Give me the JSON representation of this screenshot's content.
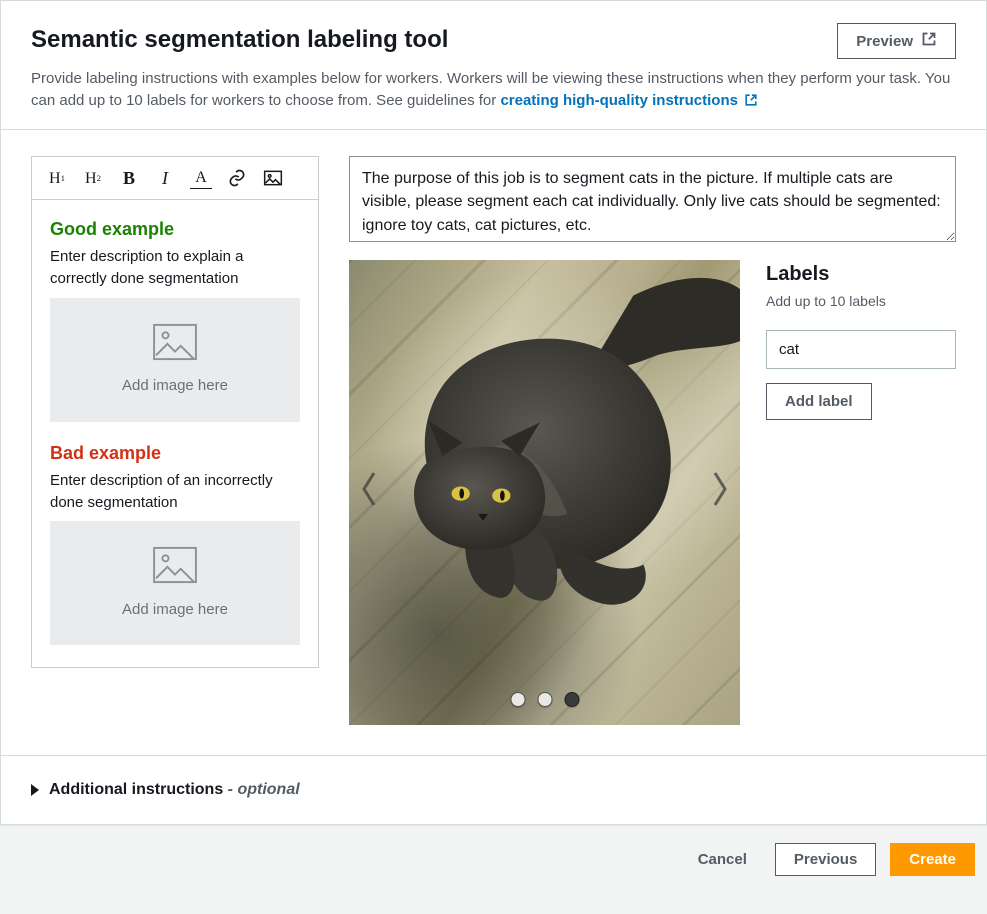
{
  "header": {
    "title": "Semantic segmentation labeling tool",
    "preview_label": "Preview",
    "description_prefix": "Provide labeling instructions with examples below for workers. Workers will be viewing these instructions when they perform your task. You can add up to 10 labels for workers to choose from. See guidelines for ",
    "description_link": "creating high-quality instructions"
  },
  "editor": {
    "toolbar": {
      "h1": "H",
      "h1_sub": "1",
      "h2": "H",
      "h2_sub": "2",
      "bold": "B",
      "italic": "I",
      "color": "A"
    },
    "good": {
      "heading": "Good example",
      "desc": "Enter description to explain a correctly done segmentation",
      "drop": "Add image here"
    },
    "bad": {
      "heading": "Bad example",
      "desc": "Enter description of an incorrectly done segmentation",
      "drop": "Add image here"
    }
  },
  "instructions": {
    "value": "The purpose of this job is to segment cats in the picture. If multiple cats are visible, please segment each cat individually. Only live cats should be segmented: ignore toy cats, cat pictures, etc."
  },
  "carousel": {
    "total": 3,
    "active_index": 2
  },
  "labels": {
    "heading": "Labels",
    "hint": "Add up to 10 labels",
    "items": [
      "cat"
    ],
    "add_label": "Add label"
  },
  "additional": {
    "label": "Additional instructions",
    "optional": "- optional"
  },
  "footer": {
    "cancel": "Cancel",
    "previous": "Previous",
    "create": "Create"
  }
}
